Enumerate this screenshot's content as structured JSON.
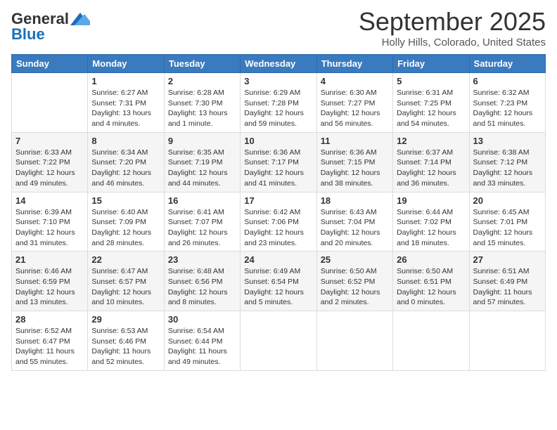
{
  "header": {
    "logo_general": "General",
    "logo_blue": "Blue",
    "title": "September 2025",
    "subtitle": "Holly Hills, Colorado, United States"
  },
  "days_of_week": [
    "Sunday",
    "Monday",
    "Tuesday",
    "Wednesday",
    "Thursday",
    "Friday",
    "Saturday"
  ],
  "weeks": [
    [
      {
        "day": "",
        "info": ""
      },
      {
        "day": "1",
        "info": "Sunrise: 6:27 AM\nSunset: 7:31 PM\nDaylight: 13 hours\nand 4 minutes."
      },
      {
        "day": "2",
        "info": "Sunrise: 6:28 AM\nSunset: 7:30 PM\nDaylight: 13 hours\nand 1 minute."
      },
      {
        "day": "3",
        "info": "Sunrise: 6:29 AM\nSunset: 7:28 PM\nDaylight: 12 hours\nand 59 minutes."
      },
      {
        "day": "4",
        "info": "Sunrise: 6:30 AM\nSunset: 7:27 PM\nDaylight: 12 hours\nand 56 minutes."
      },
      {
        "day": "5",
        "info": "Sunrise: 6:31 AM\nSunset: 7:25 PM\nDaylight: 12 hours\nand 54 minutes."
      },
      {
        "day": "6",
        "info": "Sunrise: 6:32 AM\nSunset: 7:23 PM\nDaylight: 12 hours\nand 51 minutes."
      }
    ],
    [
      {
        "day": "7",
        "info": "Sunrise: 6:33 AM\nSunset: 7:22 PM\nDaylight: 12 hours\nand 49 minutes."
      },
      {
        "day": "8",
        "info": "Sunrise: 6:34 AM\nSunset: 7:20 PM\nDaylight: 12 hours\nand 46 minutes."
      },
      {
        "day": "9",
        "info": "Sunrise: 6:35 AM\nSunset: 7:19 PM\nDaylight: 12 hours\nand 44 minutes."
      },
      {
        "day": "10",
        "info": "Sunrise: 6:36 AM\nSunset: 7:17 PM\nDaylight: 12 hours\nand 41 minutes."
      },
      {
        "day": "11",
        "info": "Sunrise: 6:36 AM\nSunset: 7:15 PM\nDaylight: 12 hours\nand 38 minutes."
      },
      {
        "day": "12",
        "info": "Sunrise: 6:37 AM\nSunset: 7:14 PM\nDaylight: 12 hours\nand 36 minutes."
      },
      {
        "day": "13",
        "info": "Sunrise: 6:38 AM\nSunset: 7:12 PM\nDaylight: 12 hours\nand 33 minutes."
      }
    ],
    [
      {
        "day": "14",
        "info": "Sunrise: 6:39 AM\nSunset: 7:10 PM\nDaylight: 12 hours\nand 31 minutes."
      },
      {
        "day": "15",
        "info": "Sunrise: 6:40 AM\nSunset: 7:09 PM\nDaylight: 12 hours\nand 28 minutes."
      },
      {
        "day": "16",
        "info": "Sunrise: 6:41 AM\nSunset: 7:07 PM\nDaylight: 12 hours\nand 26 minutes."
      },
      {
        "day": "17",
        "info": "Sunrise: 6:42 AM\nSunset: 7:06 PM\nDaylight: 12 hours\nand 23 minutes."
      },
      {
        "day": "18",
        "info": "Sunrise: 6:43 AM\nSunset: 7:04 PM\nDaylight: 12 hours\nand 20 minutes."
      },
      {
        "day": "19",
        "info": "Sunrise: 6:44 AM\nSunset: 7:02 PM\nDaylight: 12 hours\nand 18 minutes."
      },
      {
        "day": "20",
        "info": "Sunrise: 6:45 AM\nSunset: 7:01 PM\nDaylight: 12 hours\nand 15 minutes."
      }
    ],
    [
      {
        "day": "21",
        "info": "Sunrise: 6:46 AM\nSunset: 6:59 PM\nDaylight: 12 hours\nand 13 minutes."
      },
      {
        "day": "22",
        "info": "Sunrise: 6:47 AM\nSunset: 6:57 PM\nDaylight: 12 hours\nand 10 minutes."
      },
      {
        "day": "23",
        "info": "Sunrise: 6:48 AM\nSunset: 6:56 PM\nDaylight: 12 hours\nand 8 minutes."
      },
      {
        "day": "24",
        "info": "Sunrise: 6:49 AM\nSunset: 6:54 PM\nDaylight: 12 hours\nand 5 minutes."
      },
      {
        "day": "25",
        "info": "Sunrise: 6:50 AM\nSunset: 6:52 PM\nDaylight: 12 hours\nand 2 minutes."
      },
      {
        "day": "26",
        "info": "Sunrise: 6:50 AM\nSunset: 6:51 PM\nDaylight: 12 hours\nand 0 minutes."
      },
      {
        "day": "27",
        "info": "Sunrise: 6:51 AM\nSunset: 6:49 PM\nDaylight: 11 hours\nand 57 minutes."
      }
    ],
    [
      {
        "day": "28",
        "info": "Sunrise: 6:52 AM\nSunset: 6:47 PM\nDaylight: 11 hours\nand 55 minutes."
      },
      {
        "day": "29",
        "info": "Sunrise: 6:53 AM\nSunset: 6:46 PM\nDaylight: 11 hours\nand 52 minutes."
      },
      {
        "day": "30",
        "info": "Sunrise: 6:54 AM\nSunset: 6:44 PM\nDaylight: 11 hours\nand 49 minutes."
      },
      {
        "day": "",
        "info": ""
      },
      {
        "day": "",
        "info": ""
      },
      {
        "day": "",
        "info": ""
      },
      {
        "day": "",
        "info": ""
      }
    ]
  ]
}
